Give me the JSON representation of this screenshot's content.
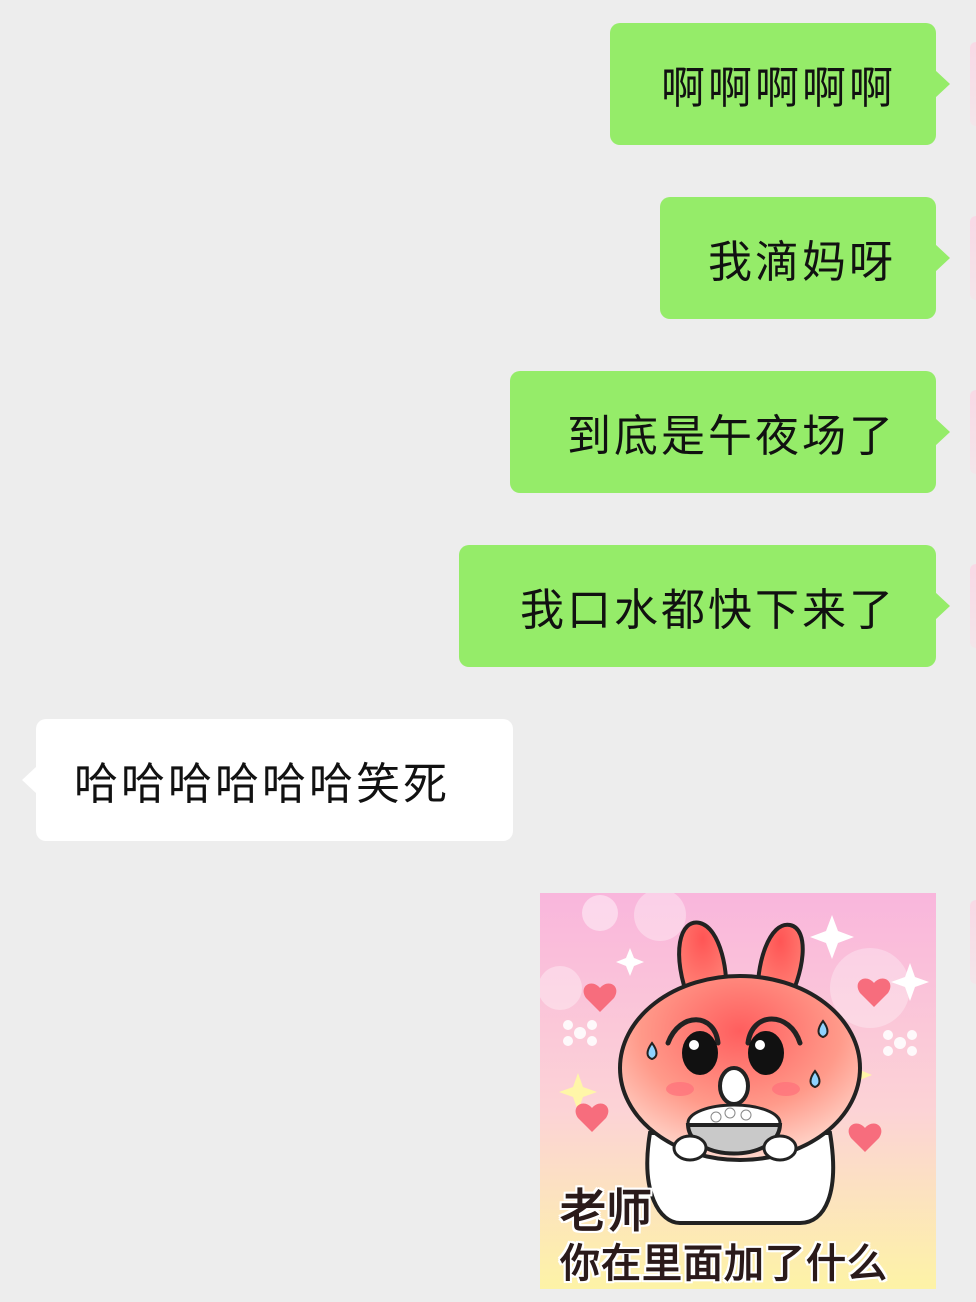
{
  "messages": [
    {
      "side": "mine",
      "text": "啊啊啊啊啊"
    },
    {
      "side": "mine",
      "text": "我滴妈呀"
    },
    {
      "side": "mine",
      "text": "到底是午夜场了"
    },
    {
      "side": "mine",
      "text": "我口水都快下来了"
    },
    {
      "side": "theirs",
      "text": "哈哈哈哈哈哈笑死"
    }
  ],
  "sticker": {
    "caption_line1": "老师",
    "caption_line2": "你在里面加了什么",
    "icon": "rabbit-eating-rice-sticker"
  },
  "colors": {
    "background": "#ededed",
    "my_bubble": "#95ec69",
    "their_bubble": "#ffffff"
  }
}
